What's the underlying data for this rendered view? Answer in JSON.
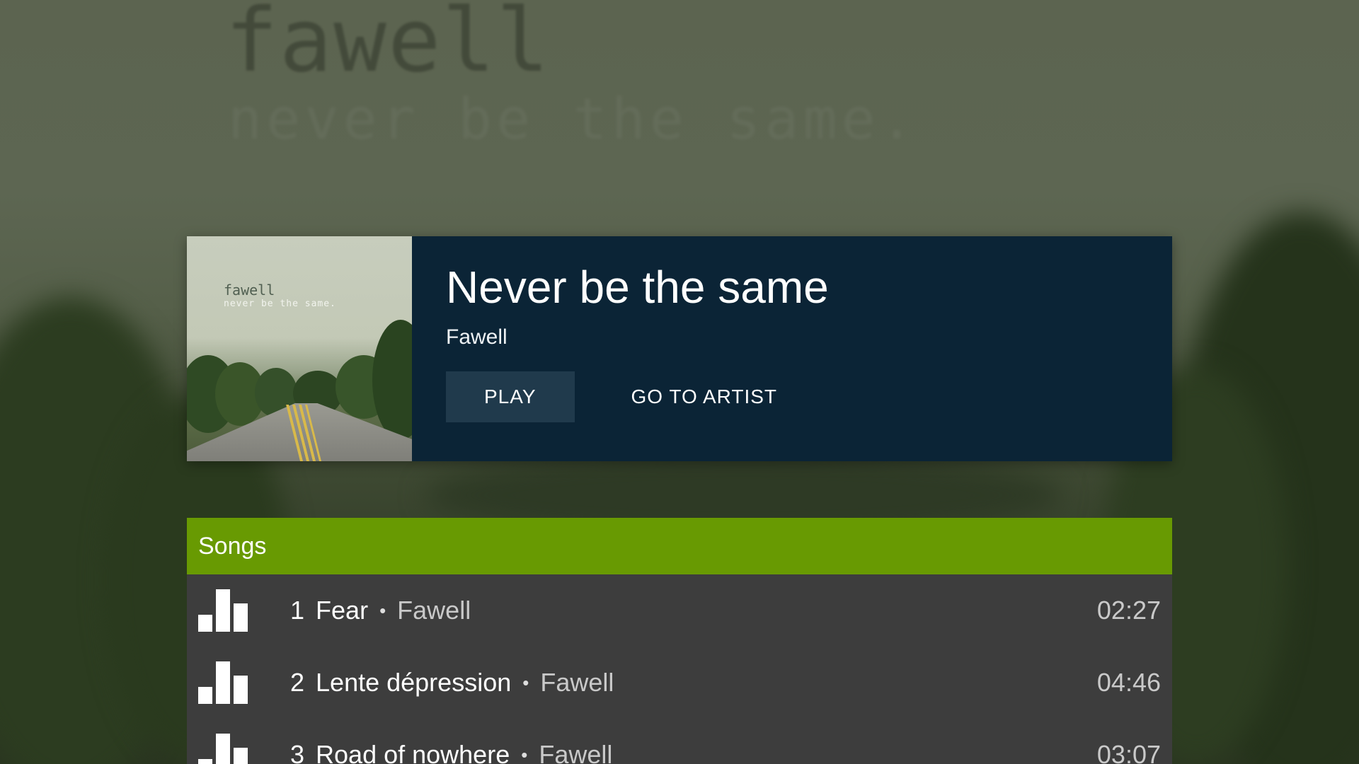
{
  "background": {
    "title": "fawell",
    "subtitle": "never be the same."
  },
  "album": {
    "cover_title": "fawell",
    "cover_subtitle": "never be the same.",
    "title": "Never be the same",
    "artist": "Fawell",
    "play_label": "PLAY",
    "go_to_artist_label": "GO TO ARTIST"
  },
  "songs": {
    "header": "Songs",
    "separator": "•",
    "items": [
      {
        "number": "1",
        "title": "Fear",
        "artist": "Fawell",
        "duration": "02:27",
        "icon": "equalizer-icon"
      },
      {
        "number": "2",
        "title": "Lente dépression",
        "artist": "Fawell",
        "duration": "04:46",
        "icon": "equalizer-icon"
      },
      {
        "number": "3",
        "title": "Road of nowhere",
        "artist": "Fawell",
        "duration": "03:07",
        "icon": "equalizer-icon"
      }
    ]
  },
  "colors": {
    "card_background": "#0b2436",
    "play_button": "#203a4c",
    "songs_header": "#689a02",
    "songs_background": "#3d3d3d"
  }
}
